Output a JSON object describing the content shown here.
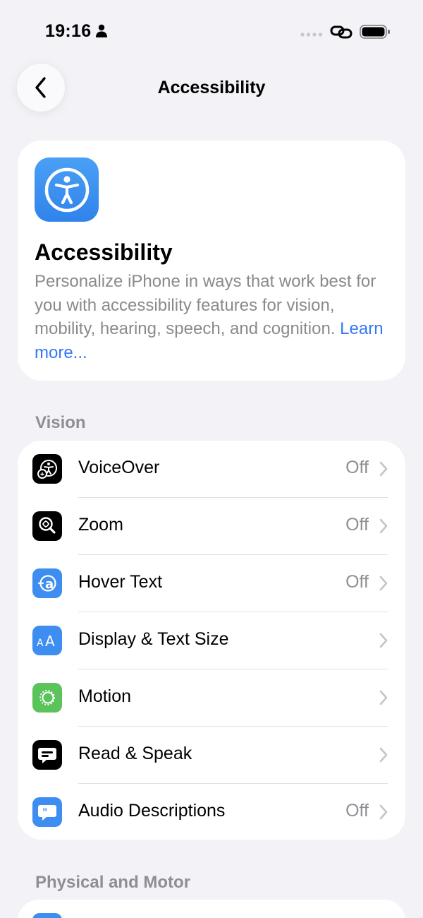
{
  "status_bar": {
    "time": "19:16",
    "icons": [
      "person-icon",
      "cellular-dots-icon",
      "link-icon",
      "battery-icon"
    ]
  },
  "nav": {
    "title": "Accessibility",
    "back_icon": "chevron-left-icon"
  },
  "header_card": {
    "icon": "accessibility-icon",
    "title": "Accessibility",
    "description": "Personalize iPhone in ways that work best for you with accessibility features for vision, mobility, hearing, speech, and cognition. ",
    "link_text": "Learn more..."
  },
  "sections": [
    {
      "header": "Vision",
      "items": [
        {
          "label": "VoiceOver",
          "value": "Off",
          "icon": "voiceover-icon",
          "icon_color": "#000000"
        },
        {
          "label": "Zoom",
          "value": "Off",
          "icon": "zoom-icon",
          "icon_color": "#000000"
        },
        {
          "label": "Hover Text",
          "value": "Off",
          "icon": "hover-text-icon",
          "icon_color": "#3d8ef0"
        },
        {
          "label": "Display & Text Size",
          "value": "",
          "icon": "text-size-icon",
          "icon_color": "#3d8ef0"
        },
        {
          "label": "Motion",
          "value": "",
          "icon": "motion-icon",
          "icon_color": "#5ac35a"
        },
        {
          "label": "Read & Speak",
          "value": "",
          "icon": "speech-bubble-icon",
          "icon_color": "#000000"
        },
        {
          "label": "Audio Descriptions",
          "value": "Off",
          "icon": "audio-descriptions-icon",
          "icon_color": "#3d8ef0"
        }
      ]
    },
    {
      "header": "Physical and Motor",
      "items": []
    }
  ],
  "colors": {
    "background": "#f2f2f7",
    "accent": "#3478f6",
    "secondary_text": "#8e8e93"
  }
}
